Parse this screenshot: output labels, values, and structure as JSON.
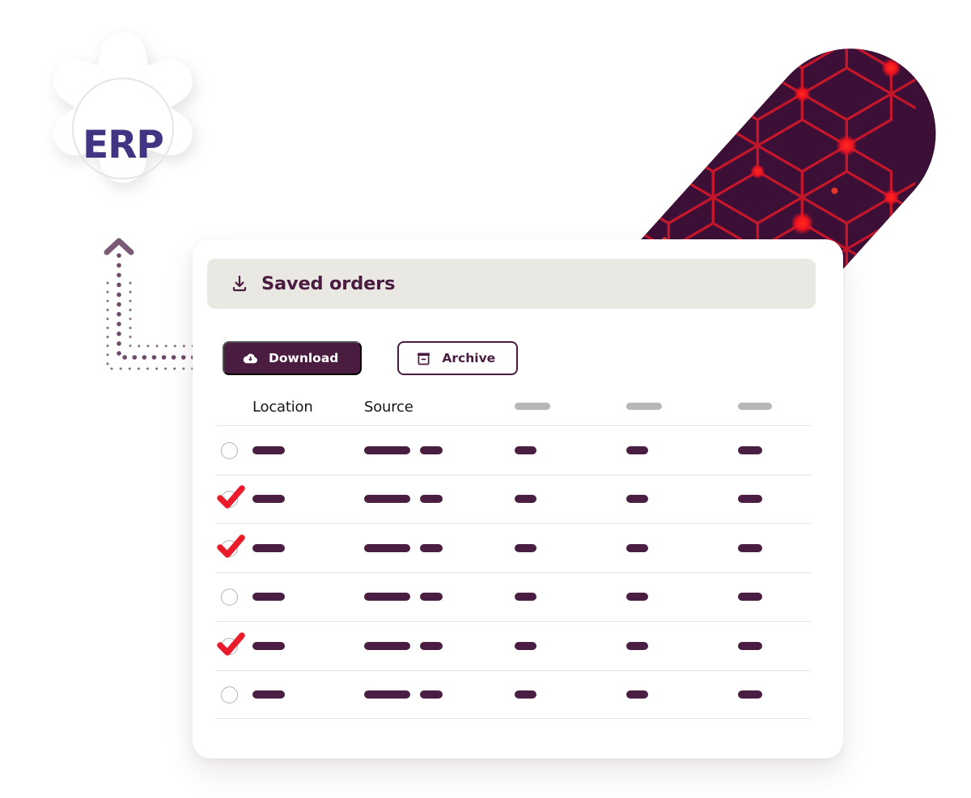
{
  "brand": {
    "badge_label": "ERP",
    "badge_text_color": "#3f3583",
    "gear_icon": "gear-icon",
    "arrow_icon": "chevron-up-icon"
  },
  "decor": {
    "shape": "rounded-capsule",
    "base_color": "#3c1036",
    "accent_color": "#ee1f2a",
    "pattern": "hexagonal-network"
  },
  "card": {
    "header": {
      "icon": "save-download-icon",
      "title": "Saved orders",
      "background_color": "#eae8e3",
      "text_color": "#4a1c40"
    },
    "actions": [
      {
        "id": "download",
        "label": "Download",
        "icon": "cloud-download-icon",
        "style": "primary",
        "background_color": "#4a1c40",
        "text_color": "#ffffff"
      },
      {
        "id": "archive",
        "label": "Archive",
        "icon": "archive-box-icon",
        "style": "secondary",
        "border_color": "#4a1c40",
        "text_color": "#4a1c40"
      }
    ],
    "table": {
      "columns": [
        {
          "key": "select",
          "label": "",
          "type": "checkbox"
        },
        {
          "key": "location",
          "label": "Location",
          "type": "text"
        },
        {
          "key": "source",
          "label": "Source",
          "type": "text"
        },
        {
          "key": "col_a",
          "label": "",
          "type": "placeholder",
          "placeholder_width": 44
        },
        {
          "key": "col_b",
          "label": "",
          "type": "placeholder",
          "placeholder_width": 44
        },
        {
          "key": "col_c",
          "label": "",
          "type": "placeholder",
          "placeholder_width": 42
        }
      ],
      "placeholder_colors": {
        "header": "#b7b7b7",
        "cell": "#4a1e42"
      },
      "check_color": "#ea1c2b",
      "rows": [
        {
          "selected": false,
          "location_w": 40,
          "source_w": [
            57,
            28
          ],
          "a_w": 27,
          "b_w": 27,
          "c_w": 30
        },
        {
          "selected": true,
          "location_w": 40,
          "source_w": [
            57,
            28
          ],
          "a_w": 27,
          "b_w": 27,
          "c_w": 30
        },
        {
          "selected": true,
          "location_w": 40,
          "source_w": [
            57,
            28
          ],
          "a_w": 27,
          "b_w": 27,
          "c_w": 30
        },
        {
          "selected": false,
          "location_w": 40,
          "source_w": [
            57,
            28
          ],
          "a_w": 27,
          "b_w": 27,
          "c_w": 30
        },
        {
          "selected": true,
          "location_w": 40,
          "source_w": [
            57,
            28
          ],
          "a_w": 27,
          "b_w": 27,
          "c_w": 30
        },
        {
          "selected": false,
          "location_w": 40,
          "source_w": [
            57,
            28
          ],
          "a_w": 27,
          "b_w": 27,
          "c_w": 30
        }
      ]
    }
  }
}
